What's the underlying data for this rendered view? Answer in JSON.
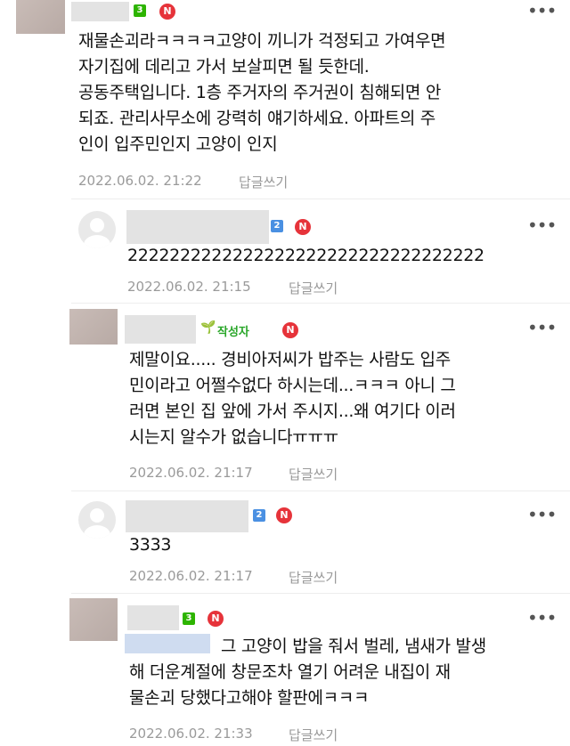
{
  "comments": [
    {
      "level": "3",
      "badge": "N",
      "more": "•••",
      "lines": [
        "재물손괴라ㅋㅋㅋㅋ고양이 끼니가 걱정되고 가여우면",
        "자기집에 데리고 가서 보살피면 될 듯한데.",
        "공동주택입니다. 1층 주거자의 주거권이 침해되면 안",
        "되죠. 관리사무소에 강력히 얘기하세요. 아파트의 주",
        "인이 입주민인지 고양이 인지"
      ],
      "time": "2022.06.02. 21:22",
      "reply": "답글쓰기"
    },
    {
      "level": "2",
      "badge": "N",
      "more": "•••",
      "lines": [
        "2222222222222222222222222222222222"
      ],
      "time": "2022.06.02. 21:15",
      "reply": "답글쓰기"
    },
    {
      "author_badge": "작성자",
      "badge": "N",
      "more": "•••",
      "lines": [
        "제말이요..... 경비아저씨가 밥주는 사람도 입주",
        "민이라고 어쩔수없다 하시는데...ㅋㅋㅋ 아니 그",
        "러면 본인 집 앞에 가서 주시지...왜 여기다 이러",
        "시는지 알수가 없습니다ㅠㅠㅠ"
      ],
      "time": "2022.06.02. 21:17",
      "reply": "답글쓰기"
    },
    {
      "level": "2",
      "badge": "N",
      "more": "•••",
      "lines": [
        "3333"
      ],
      "time": "2022.06.02. 21:17",
      "reply": "답글쓰기"
    },
    {
      "level": "3",
      "badge": "N",
      "more": "•••",
      "lines": [
        "그 고양이 밥을 줘서 벌레, 냄새가 발생",
        "해 더운계절에 창문조차 열기 어려운 내집이 재",
        "물손괴 당했다고해야 할판에ㅋㅋㅋ"
      ],
      "time": "2022.06.02. 21:33",
      "reply": "답글쓰기"
    }
  ],
  "colors": {
    "level_green": "#2db400",
    "level_blue": "#4a90e2",
    "new_badge": "#e6333a",
    "author_badge": "#29a629",
    "meta_text": "#9a9a9a"
  }
}
